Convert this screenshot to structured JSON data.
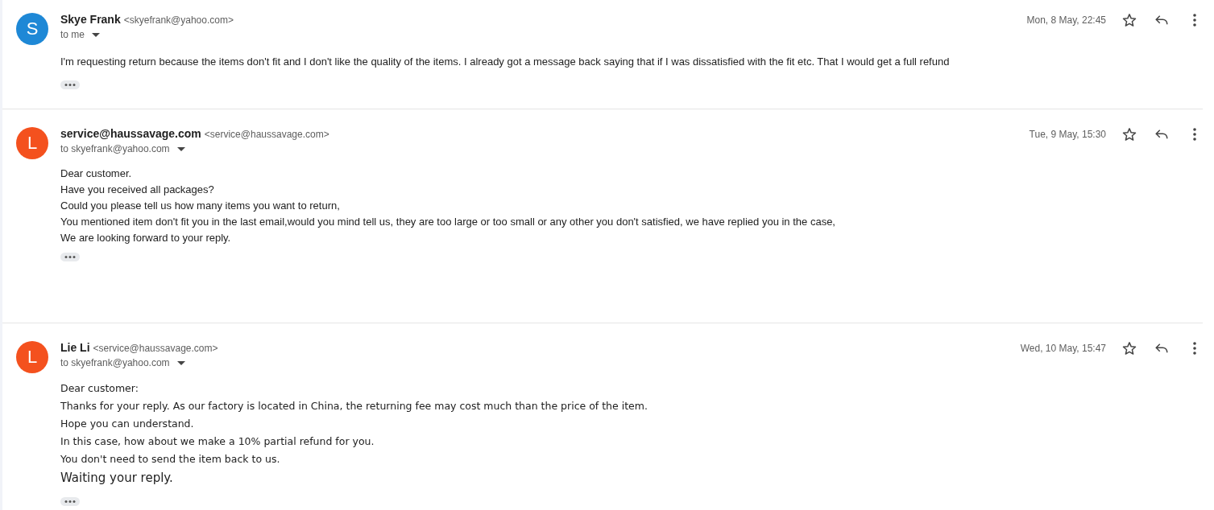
{
  "messages": [
    {
      "avatar": {
        "letter": "S",
        "color": "#1e88d6"
      },
      "sender": "Skye Frank",
      "address": "<skyefrank@yahoo.com>",
      "recipient": "to me",
      "date": "Mon, 8 May, 22:45",
      "starred": false,
      "body": [
        {
          "kind": "plain",
          "text": "I'm requesting return because the items don't fit and I don't like the quality of the items. I already got a message back saying that if I was dissatisfied with the fit etc. That I would get a full refund"
        }
      ]
    },
    {
      "avatar": {
        "letter": "L",
        "color": "#f4511e"
      },
      "sender": "service@haussavage.com",
      "address": "<service@haussavage.com>",
      "recipient": "to skyefrank@yahoo.com",
      "date": "Tue, 9 May, 15:30",
      "starred": false,
      "body": [
        {
          "kind": "plain",
          "text": "Dear customer."
        },
        {
          "kind": "plain",
          "text": "Have you received all packages?"
        },
        {
          "kind": "plain",
          "text": "Could you please tell us how many items you want to return,"
        },
        {
          "kind": "plain",
          "text": "You mentioned item don't fit you in the last email,would you mind tell us, they are too large or too small or any other you don't satisfied, we have replied you in the case,"
        },
        {
          "kind": "plain",
          "text": "We are looking forward to your reply."
        }
      ]
    },
    {
      "avatar": {
        "letter": "L",
        "color": "#f4511e"
      },
      "sender": "Lie Li",
      "address": "<service@haussavage.com>",
      "recipient": "to skyefrank@yahoo.com",
      "date": "Wed, 10 May, 15:47",
      "starred": false,
      "body": [
        {
          "kind": "formatted",
          "text": "Dear customer:"
        },
        {
          "kind": "formatted",
          "text": "Thanks for your reply. As our factory is located in China, the returning fee may cost much than the price of the item."
        },
        {
          "kind": "formatted",
          "text": "Hope you can understand."
        },
        {
          "kind": "formatted",
          "text": "In this case, how about we make a 10% partial refund for you."
        },
        {
          "kind": "formatted",
          "text": "You don't need to send the item back to us."
        },
        {
          "kind": "large",
          "text": "Waiting your reply."
        }
      ]
    }
  ]
}
